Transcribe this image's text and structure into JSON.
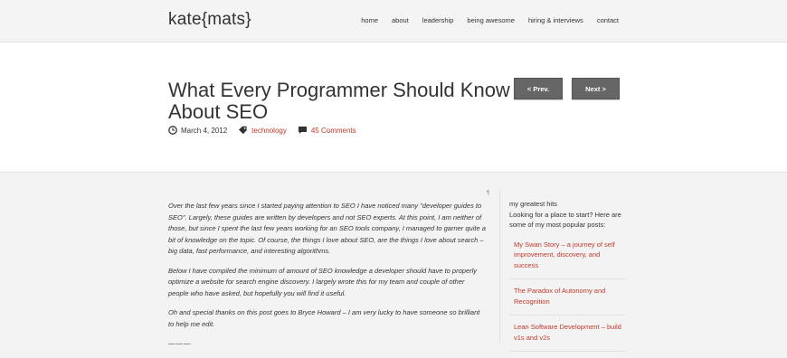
{
  "header": {
    "logo": "kate{mats}",
    "nav": [
      "home",
      "about",
      "leadership",
      "being awesome",
      "hiring & interviews",
      "contact"
    ]
  },
  "post": {
    "title": "What Every Programmer Should Know About SEO",
    "date": "March 4, 2012",
    "category": "technology",
    "comments": "45 Comments",
    "prev_label": "< Prev.",
    "next_label": "Next >",
    "pilcrow": "¶",
    "paragraphs": [
      "Over the last few years since I started paying attention to SEO I have noticed many \"developer guides to SEO\". Largely, these guides are written by developers and not SEO experts.  At this point, I am neither of those, but since I spent the last few years working for an SEO tools company, I managed to garner quite a bit of knowledge on the topic.  Of course, the things I love about SEO, are the things I love about search – big data, fast performance, and interesting algorithms.",
      "Below I have compiled the minimum of amount of SEO knowledge a developer should have to properly optimize a website for search engine discovery.  I largely wrote this for my team and couple of other people who have asked, but hopefully you will find it useful.",
      "Oh and special thanks on this post goes to Bryce Howard – I am very lucky to have someone so brilliant to help me edit."
    ],
    "rule": "———"
  },
  "sidebar": {
    "heading": "my greatest hits",
    "intro": "Looking for a place to start? Here are some of my most popular posts:",
    "links": [
      "My Swan Story – a journey of self improvement, discovery, and success",
      "The Paradox of Autonomy and Recognition",
      "Lean Software Development – build v1s and v2s"
    ]
  },
  "colors": {
    "accent": "#c0392b",
    "button": "#666666"
  },
  "icons": [
    "clock-icon",
    "tag-icon",
    "comment-icon"
  ]
}
